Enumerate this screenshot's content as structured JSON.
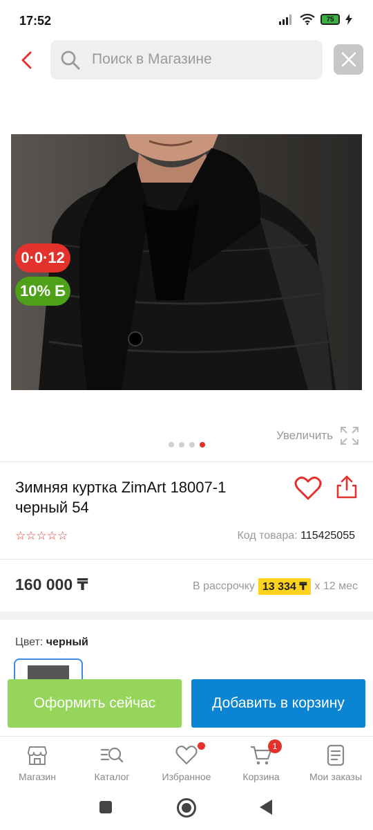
{
  "status": {
    "time": "17:52",
    "battery": "75"
  },
  "header": {
    "search_placeholder": "Поиск в Магазине"
  },
  "product": {
    "badge_installment": "0·0·12",
    "badge_bonus": "10% Б",
    "zoom_label": "Увеличить",
    "title": "Зимняя куртка ZimArt 18007-1 черный 54",
    "rating_stars": "☆☆☆☆☆",
    "sku_label": "Код товара:",
    "sku_value": "115425055",
    "price": "160 000 ₸",
    "installment_prefix": "В рассрочку",
    "installment_amount": "13 334 ₸",
    "installment_suffix": "х 12 мес",
    "color_label": "Цвет:",
    "color_value": "черный",
    "image_dots_total": 4,
    "image_dot_active": 4
  },
  "actions": {
    "buy_now": "Оформить сейчас",
    "add_to_cart": "Добавить в корзину"
  },
  "bottom_nav": {
    "items": [
      {
        "label": "Магазин",
        "icon": "shop-icon"
      },
      {
        "label": "Каталог",
        "icon": "catalog-search-icon"
      },
      {
        "label": "Избранное",
        "icon": "heart-icon"
      },
      {
        "label": "Корзина",
        "icon": "cart-icon",
        "badge": "1"
      },
      {
        "label": "Мои заказы",
        "icon": "orders-icon"
      }
    ]
  },
  "colors": {
    "accent_red": "#e3322b",
    "buy_green": "#94d55a",
    "cart_blue": "#0a84d3",
    "installment_yellow": "#ffd21e",
    "bonus_green": "#4ea019"
  }
}
